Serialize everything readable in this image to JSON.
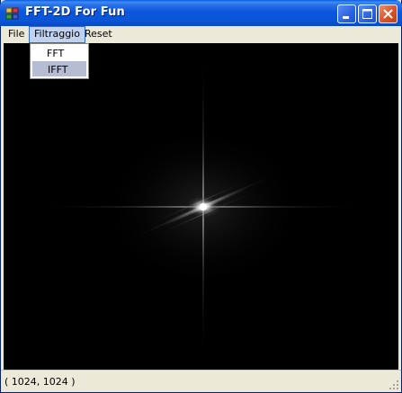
{
  "window": {
    "title": "FFT-2D For Fun"
  },
  "menu": {
    "file": "File",
    "filtraggio": "Filtraggio",
    "reset": "Reset"
  },
  "dropdown": {
    "items": [
      "FFT",
      "IFFT"
    ],
    "highlighted": "IFFT"
  },
  "statusbar": {
    "text": "( 1024, 1024 )"
  },
  "icons": {
    "app": "app-icon",
    "minimize": "minimize-icon",
    "maximize": "maximize-icon",
    "close": "close-icon",
    "grip": "resize-grip-icon"
  },
  "colors": {
    "titlebar": "#0a55d6",
    "menu_highlight": "#c1d2ee",
    "dropdown_highlight": "#b6bdd2",
    "canvas_bg": "#000000"
  }
}
